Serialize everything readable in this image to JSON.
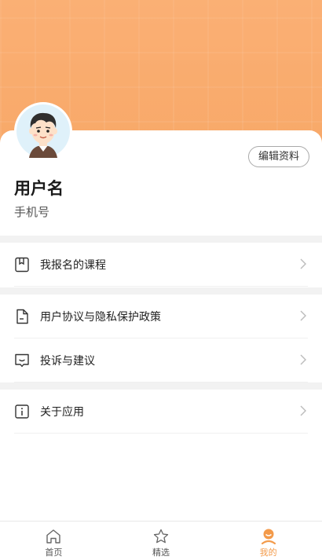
{
  "profile": {
    "username": "用户名",
    "phone": "手机号",
    "edit_label": "编辑资料"
  },
  "menu": {
    "group1": [
      {
        "label": "我报名的课程",
        "icon": "bookmark-book-icon"
      }
    ],
    "group2": [
      {
        "label": "用户协议与隐私保护政策",
        "icon": "document-icon"
      },
      {
        "label": "投诉与建议",
        "icon": "feedback-icon"
      }
    ],
    "group3": [
      {
        "label": "关于应用",
        "icon": "info-icon"
      }
    ]
  },
  "tabs": [
    {
      "label": "首页",
      "icon": "home-icon"
    },
    {
      "label": "精选",
      "icon": "star-icon"
    },
    {
      "label": "我的",
      "icon": "profile-icon",
      "active": true
    }
  ],
  "colors": {
    "accent": "#f39a4a",
    "header": "#f8a868"
  }
}
